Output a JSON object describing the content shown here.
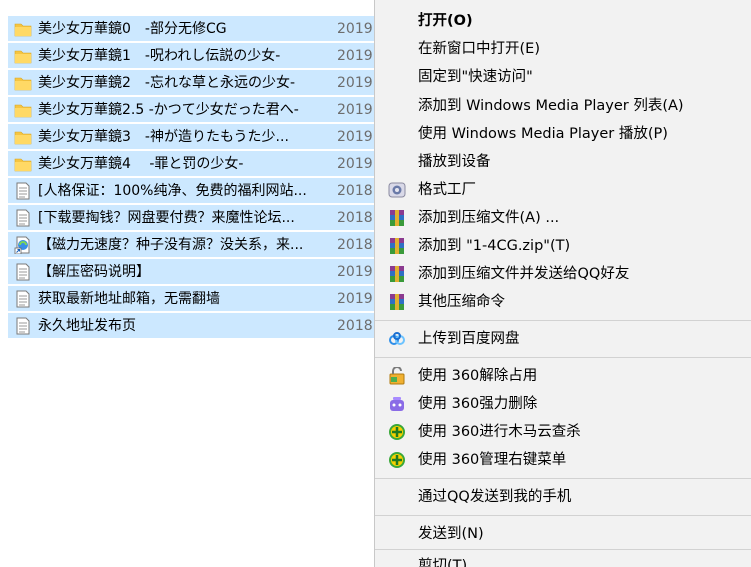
{
  "files": [
    {
      "name": "美少女万華鏡0　-部分无修CG",
      "date": "2019",
      "icon": "folder-icon"
    },
    {
      "name": "美少女万華鏡1　-呪われし伝説の少女-",
      "date": "2019",
      "icon": "folder-icon"
    },
    {
      "name": "美少女万華鏡2　-忘れな草と永远の少女-",
      "date": "2019",
      "icon": "folder-icon"
    },
    {
      "name": "美少女万華鏡2.5 -かつて少女だった君へ-",
      "date": "2019",
      "icon": "folder-icon"
    },
    {
      "name": "美少女万華鏡3　-神が造りたもうた少...",
      "date": "2019",
      "icon": "folder-icon"
    },
    {
      "name": "美少女万華鏡4　 -罪と罚の少女-",
      "date": "2019",
      "icon": "folder-icon"
    },
    {
      "name": "[人格保证：100%纯净、免费的福利网站...",
      "date": "2018",
      "icon": "text-file-icon"
    },
    {
      "name": "[下载要掏钱？网盘要付费？来魔性论坛...",
      "date": "2018",
      "icon": "text-file-icon"
    },
    {
      "name": "【磁力无速度？种子没有源？没关系，来...",
      "date": "2018",
      "icon": "shortcut-file-icon"
    },
    {
      "name": "【解压密码说明】",
      "date": "2019",
      "icon": "text-file-icon"
    },
    {
      "name": "获取最新地址邮箱，无需翻墙",
      "date": "2019",
      "icon": "text-file-icon"
    },
    {
      "name": "永久地址发布页",
      "date": "2018",
      "icon": "text-file-icon"
    }
  ],
  "menu": {
    "items": [
      {
        "label": "打开(O)",
        "bold": true,
        "icon": ""
      },
      {
        "label": "在新窗口中打开(E)",
        "icon": ""
      },
      {
        "label": "固定到\"快速访问\"",
        "icon": ""
      },
      {
        "label": "添加到 Windows Media Player 列表(A)",
        "icon": ""
      },
      {
        "label": "使用 Windows Media Player 播放(P)",
        "icon": ""
      },
      {
        "label": "播放到设备",
        "icon": ""
      },
      {
        "label": "格式工厂",
        "icon": "format-factory-icon"
      },
      {
        "label": "添加到压缩文件(A) ...",
        "icon": "winrar-icon"
      },
      {
        "label": "添加到 \"1-4CG.zip\"(T)",
        "icon": "winrar-icon"
      },
      {
        "label": "添加到压缩文件并发送给QQ好友",
        "icon": "winrar-icon"
      },
      {
        "label": "其他压缩命令",
        "icon": "winrar-icon"
      },
      {
        "label": "上传到百度网盘",
        "icon": "baidu-netdisk-icon"
      },
      {
        "label": "使用 360解除占用",
        "icon": "unlock-360-icon"
      },
      {
        "label": "使用 360强力删除",
        "icon": "delete-360-icon"
      },
      {
        "label": "使用 360进行木马云查杀",
        "icon": "scan-360-icon"
      },
      {
        "label": "使用 360管理右键菜单",
        "icon": "manage-360-icon"
      },
      {
        "label": "通过QQ发送到我的手机",
        "icon": ""
      },
      {
        "label": "发送到(N)",
        "icon": ""
      },
      {
        "label": "剪切(T)",
        "icon": ""
      }
    ]
  },
  "colors": {
    "selection": "#cce8ff",
    "menu_background": "#f2f2f2",
    "separator": "#d2d2d2",
    "folder": "#f5c542",
    "date_text": "#6d6d6d"
  }
}
